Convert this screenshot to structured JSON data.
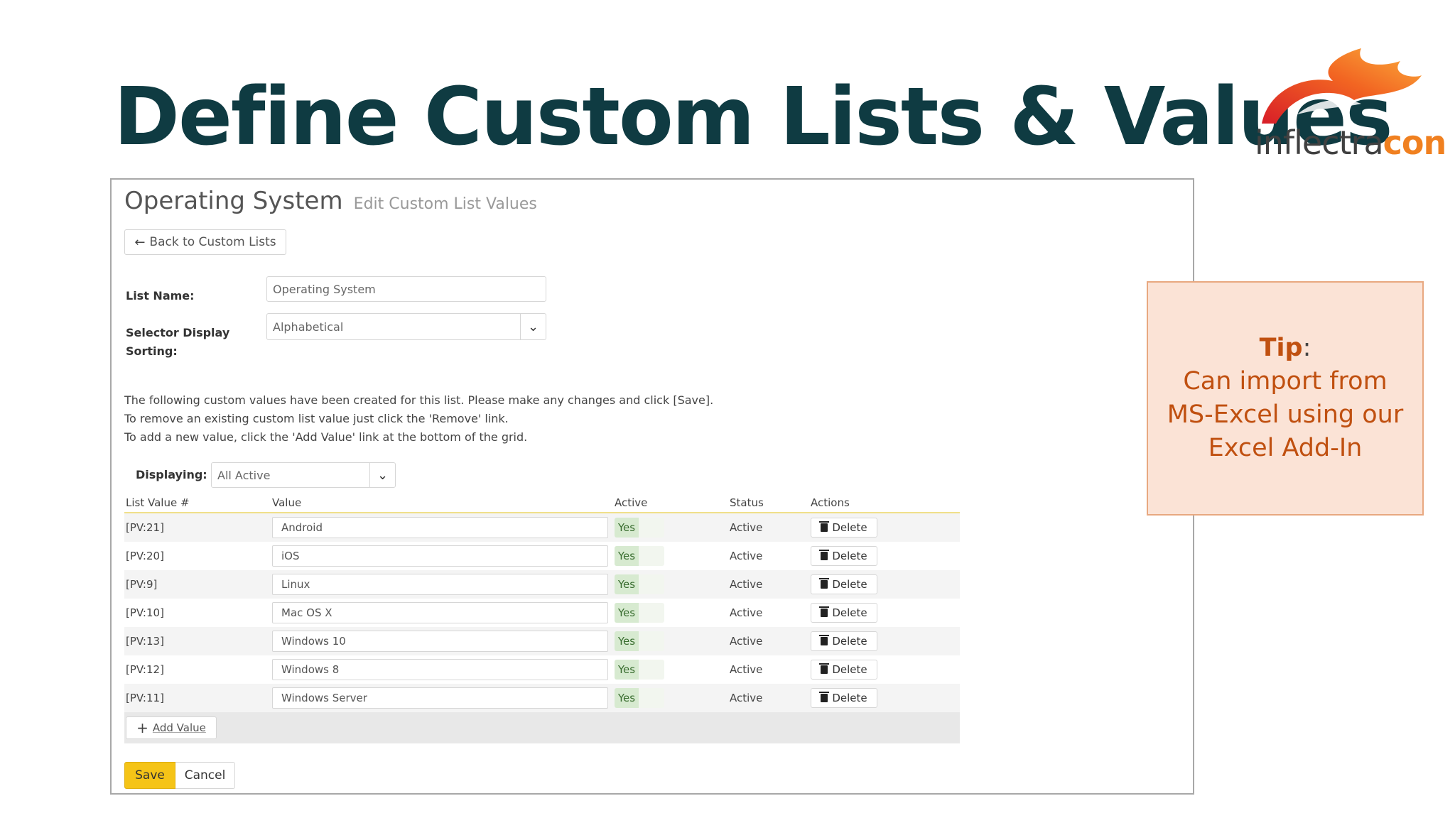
{
  "slide": {
    "title": "Define Custom Lists & Values",
    "logo": {
      "part1": "inflectra",
      "part2": "con"
    }
  },
  "page": {
    "title": "Operating System",
    "subtitle": "Edit Custom List Values",
    "back_label": "Back to Custom Lists"
  },
  "form": {
    "list_name_label": "List Name:",
    "list_name_value": "Operating System",
    "sorting_label_1": "Selector Display",
    "sorting_label_2": "Sorting:",
    "sorting_value": "Alphabetical",
    "instructions": [
      "The following custom values have been created for this list. Please make any changes and click [Save].",
      "To remove an existing custom list value just click the 'Remove' link.",
      "To add a new value, click the 'Add Value' link at the bottom of the grid."
    ],
    "displaying_label": "Displaying:",
    "displaying_value": "All Active"
  },
  "grid": {
    "headers": [
      "List Value #",
      "Value",
      "Active",
      "Status",
      "Actions"
    ],
    "rows": [
      {
        "id": "[PV:21]",
        "value": "Android",
        "active": "Yes",
        "status": "Active",
        "action": "Delete"
      },
      {
        "id": "[PV:20]",
        "value": "iOS",
        "active": "Yes",
        "status": "Active",
        "action": "Delete"
      },
      {
        "id": "[PV:9]",
        "value": "Linux",
        "active": "Yes",
        "status": "Active",
        "action": "Delete"
      },
      {
        "id": "[PV:10]",
        "value": "Mac OS X",
        "active": "Yes",
        "status": "Active",
        "action": "Delete"
      },
      {
        "id": "[PV:13]",
        "value": "Windows 10",
        "active": "Yes",
        "status": "Active",
        "action": "Delete"
      },
      {
        "id": "[PV:12]",
        "value": "Windows 8",
        "active": "Yes",
        "status": "Active",
        "action": "Delete"
      },
      {
        "id": "[PV:11]",
        "value": "Windows Server",
        "active": "Yes",
        "status": "Active",
        "action": "Delete"
      }
    ],
    "add_label": "Add Value"
  },
  "footer": {
    "save_label": "Save",
    "cancel_label": "Cancel"
  },
  "tip": {
    "title": "Tip",
    "colon": ":",
    "lines": [
      "Can import from",
      "MS-Excel using our",
      "Excel Add-In"
    ]
  },
  "colors": {
    "title": "#0f3b42",
    "accent_save": "#f5c417",
    "tip_text": "#c05010",
    "tip_bg": "#fbe3d6"
  },
  "icons": [
    "flame-logo-icon",
    "arrow-left-icon",
    "chevron-down-icon",
    "trash-icon",
    "plus-icon"
  ]
}
